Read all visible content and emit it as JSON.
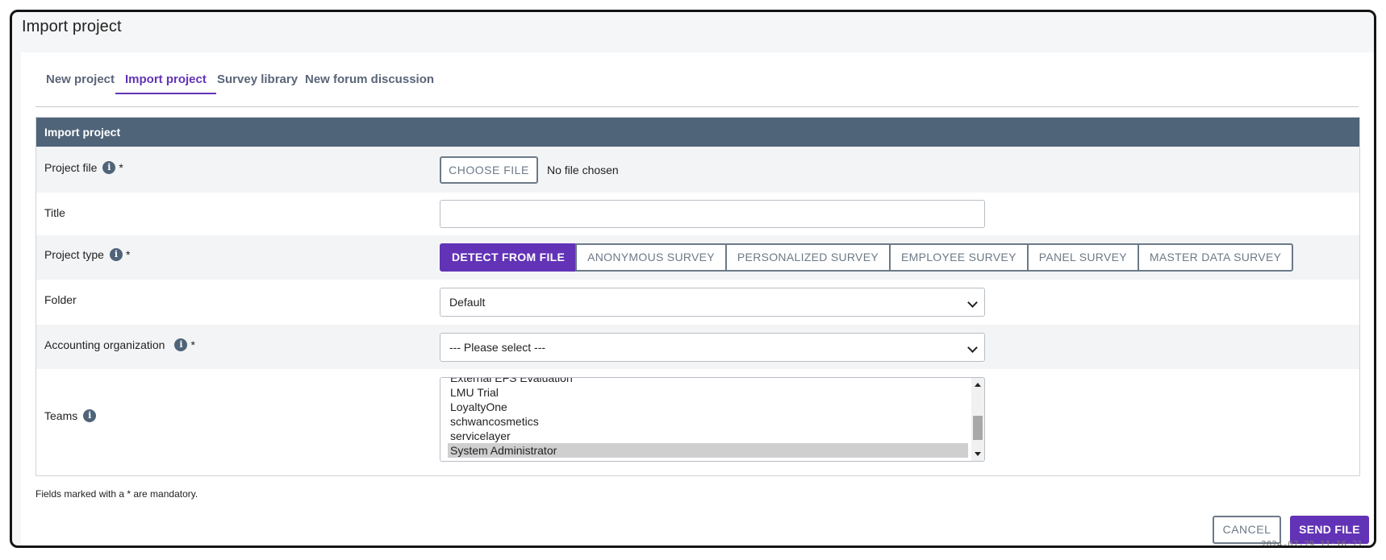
{
  "window": {
    "title": "Import project"
  },
  "tabs": [
    {
      "label": "New project"
    },
    {
      "label": "Import project"
    },
    {
      "label": "Survey library"
    },
    {
      "label": "New forum discussion"
    }
  ],
  "active_tab": "Import project",
  "panel": {
    "title": "Import project"
  },
  "form": {
    "project_file": {
      "label": "Project file",
      "required_mark": "*",
      "button_label": "CHOOSE FILE",
      "status": "No file chosen"
    },
    "title": {
      "label": "Title",
      "value": ""
    },
    "project_type": {
      "label": "Project type",
      "required_mark": "*",
      "options": [
        "DETECT FROM FILE",
        "ANONYMOUS SURVEY",
        "PERSONALIZED SURVEY",
        "EMPLOYEE SURVEY",
        "PANEL SURVEY",
        "MASTER DATA SURVEY"
      ],
      "selected": "DETECT FROM FILE"
    },
    "folder": {
      "label": "Folder",
      "value": "Default"
    },
    "accounting_organization": {
      "label": "Accounting organization",
      "required_mark": "*",
      "value": "--- Please select ---"
    },
    "teams": {
      "label": "Teams",
      "items": [
        "External EFS Evaluation",
        "LMU Trial",
        "LoyaltyOne",
        "schwancosmetics",
        "servicelayer",
        "System Administrator"
      ],
      "selected": "System Administrator"
    }
  },
  "footnote": "Fields marked with a * are mandatory.",
  "actions": {
    "cancel_label": "CANCEL",
    "send_label": "SEND FILE"
  },
  "timestamp": "2024-07-29 11:16:21",
  "colors": {
    "accent": "#6233b6",
    "header": "#4f6479",
    "secondary": "#6c7a88"
  },
  "icons": {
    "info": "info-icon",
    "dropdown": "chevron-down-icon"
  }
}
